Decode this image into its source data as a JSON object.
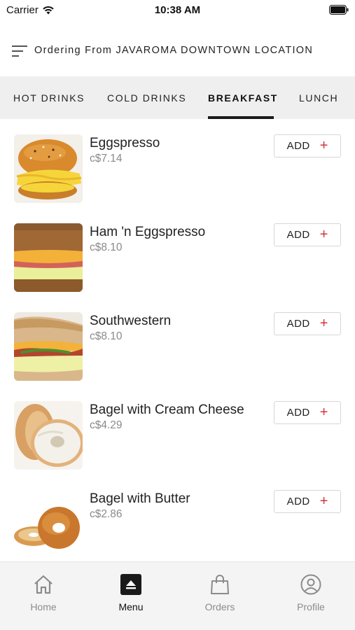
{
  "status_bar": {
    "carrier": "Carrier",
    "time": "10:38 AM"
  },
  "header": {
    "text": "Ordering From JAVAROMA DOWNTOWN LOCATION"
  },
  "tabs": [
    {
      "label": "HOT DRINKS",
      "active": false
    },
    {
      "label": "COLD DRINKS",
      "active": false
    },
    {
      "label": "BREAKFAST",
      "active": true
    },
    {
      "label": "LUNCH",
      "active": false
    }
  ],
  "items": [
    {
      "name": "Eggspresso",
      "price": "c$7.14",
      "add_label": "ADD",
      "image": "sandwich-icon"
    },
    {
      "name": "Ham 'n Eggspresso",
      "price": "c$8.10",
      "add_label": "ADD",
      "image": "sandwich-icon"
    },
    {
      "name": "Southwestern",
      "price": "c$8.10",
      "add_label": "ADD",
      "image": "sandwich-icon"
    },
    {
      "name": "Bagel with Cream Cheese",
      "price": "c$4.29",
      "add_label": "ADD",
      "image": "bagel-icon"
    },
    {
      "name": "Bagel with Butter",
      "price": "c$2.86",
      "add_label": "ADD",
      "image": "bagel-icon"
    }
  ],
  "bottom_nav": [
    {
      "label": "Home",
      "icon": "home-icon",
      "active": false
    },
    {
      "label": "Menu",
      "icon": "menu-icon",
      "active": true
    },
    {
      "label": "Orders",
      "icon": "shopping-bag-icon",
      "active": false
    },
    {
      "label": "Profile",
      "icon": "profile-icon",
      "active": false
    }
  ],
  "colors": {
    "accent": "#d0363a",
    "tab_bar": "#efefef",
    "nav_bar": "#f4f4f4",
    "price": "#8a8a8a"
  }
}
